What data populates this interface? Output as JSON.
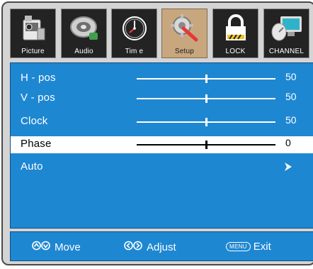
{
  "tabs": [
    {
      "label": "Picture",
      "icon": "tv-icon",
      "active": false
    },
    {
      "label": "Audio",
      "icon": "speaker-icon",
      "active": false
    },
    {
      "label": "Tim e",
      "icon": "clock-icon",
      "active": false
    },
    {
      "label": "Setup",
      "icon": "wrench-icon",
      "active": true
    },
    {
      "label": "LOCK",
      "icon": "lock-icon",
      "active": false
    },
    {
      "label": "CHANNEL",
      "icon": "satellite-icon",
      "active": false
    }
  ],
  "settings": [
    {
      "label": "H - pos",
      "value": "50",
      "level": 0.5
    },
    {
      "label": "V - pos",
      "value": "50",
      "level": 0.5
    },
    {
      "label": "Clock",
      "value": "50",
      "level": 0.5
    },
    {
      "label": "Phase",
      "value": "0",
      "level": 0.5,
      "selected": true
    },
    {
      "label": "Auto"
    }
  ],
  "footer": {
    "move_label": "Move",
    "adjust_label": "Adjust",
    "menu_key": "MENU",
    "exit_label": "Exit"
  },
  "colors": {
    "panel": "#1e87d2",
    "active_tab": "#c8a77e",
    "tab": "#232323"
  }
}
